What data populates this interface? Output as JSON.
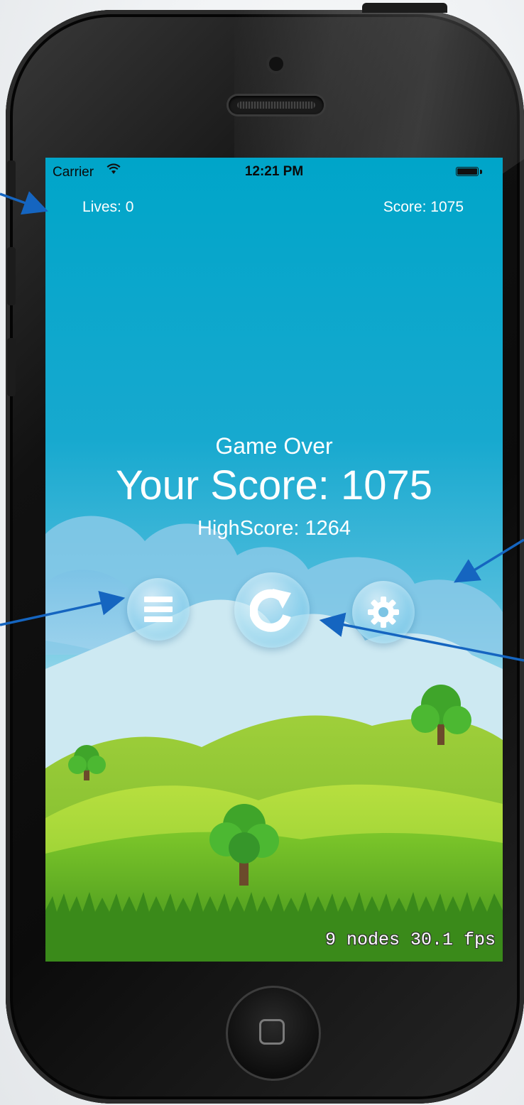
{
  "status_bar": {
    "carrier": "Carrier",
    "time": "12:21 PM",
    "wifi_icon": "wifi-icon",
    "battery_icon": "battery-icon"
  },
  "hud": {
    "lives": "Lives: 0",
    "score": "Score: 1075"
  },
  "game_over": {
    "title": "Game Over",
    "your_score": "Your Score: 1075",
    "highscore": "HighScore: 1264"
  },
  "buttons": {
    "menu_icon": "menu-icon",
    "replay_icon": "replay-icon",
    "settings_icon": "gear-icon"
  },
  "debug": {
    "stats": "9 nodes 30.1 fps"
  },
  "colors": {
    "sky_top": "#00a5c9",
    "sky_bottom": "#d8f0f6",
    "grass": "#7cc62a",
    "arrow": "#1565c0"
  }
}
